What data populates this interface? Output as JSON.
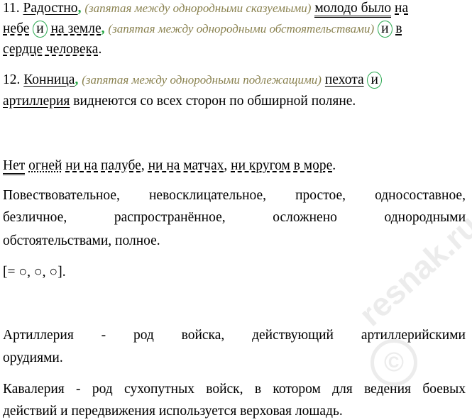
{
  "item11": {
    "num": "11.",
    "w_radostno": "Радостно",
    "comma": ",",
    "note1": "(запятая между однородными сказуемыми)",
    "w_molodo": "молодо было",
    "w_na1": "на",
    "w_nebe": "небе",
    "w_i1": "и",
    "w_na_zemle": "на земле",
    "note2": "(запятая между однородными обстоятельствами)",
    "w_i2": "и",
    "w_v": "в",
    "w_serdce": "сердце человека",
    "end": "."
  },
  "item12": {
    "num": "12.",
    "w_konnica": "Конница",
    "comma": ",",
    "note": "(запятая между однородными подлежащими)",
    "w_pehota": "пехота",
    "w_i": "и",
    "w_artilleriya": "артиллерия",
    "rest": "виднеются со всех сторон по обширной поляне."
  },
  "sentence": {
    "w_net": "Нет",
    "w_ogney": "огней",
    "w_palube": "ни на палубе",
    "w_matchah": "ни на матчах",
    "w_more": "ни кругом в море",
    "sep": ",",
    "end": "."
  },
  "analysis": {
    "line1": [
      "Повествовательное,",
      "невосклицательное,",
      "простое,",
      "односоставное,"
    ],
    "line2": [
      "безличное,",
      "распространённое,",
      "осложнено",
      "однородными"
    ],
    "line3": "обстоятельствами, полное."
  },
  "scheme": "[= ○, ○, ○].",
  "definitions": {
    "artilleriya_line1": [
      "Артиллерия",
      "-",
      "род",
      "войска,",
      "действующий",
      "артиллерийскими"
    ],
    "artilleriya_line2": "орудиями.",
    "kavaleriya_line1": [
      "Кавалерия",
      "-",
      "род",
      "сухопутных",
      "войск,",
      "в",
      "котором",
      "для",
      "ведения",
      "боевых"
    ],
    "kavaleriya_line2": "действий и передвижения используется верховая лошадь."
  },
  "watermark": "resnak.ru",
  "watermark_symbol": "©"
}
